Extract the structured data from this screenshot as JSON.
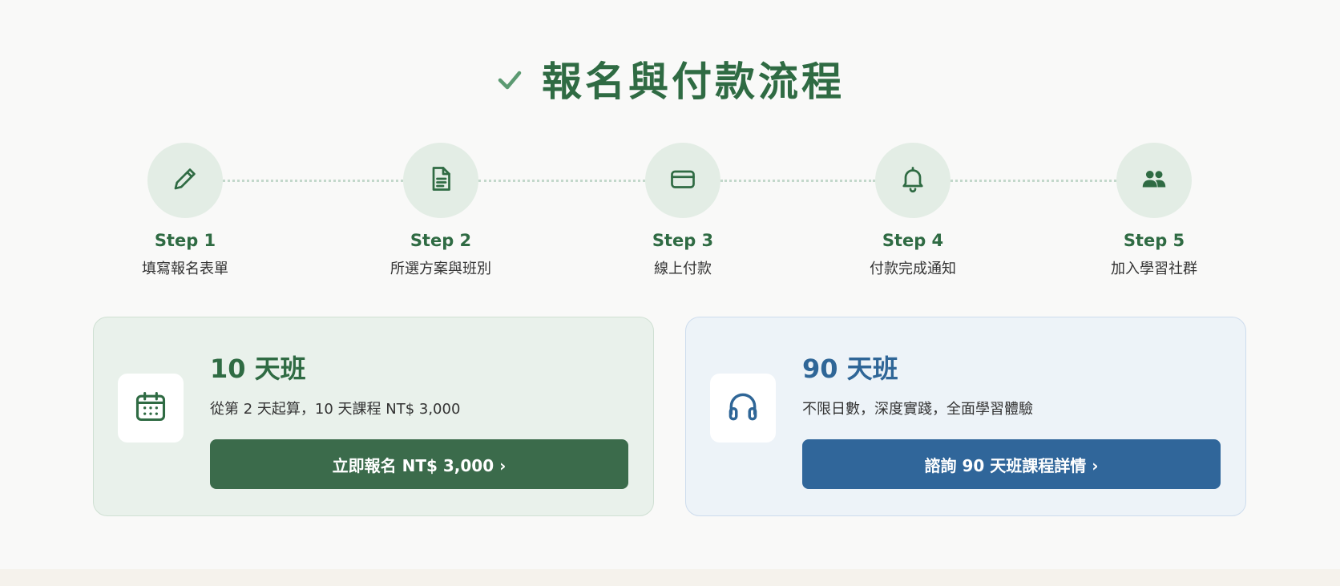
{
  "title": {
    "text": "報名與付款流程",
    "icon": "check-icon"
  },
  "steps": [
    {
      "label": "Step 1",
      "desc": "填寫報名表單",
      "icon": "pencil-icon"
    },
    {
      "label": "Step 2",
      "desc": "所選方案與班別",
      "icon": "document-icon"
    },
    {
      "label": "Step 3",
      "desc": "線上付款",
      "icon": "credit-card-icon"
    },
    {
      "label": "Step 4",
      "desc": "付款完成通知",
      "icon": "bell-icon"
    },
    {
      "label": "Step 5",
      "desc": "加入學習社群",
      "icon": "users-icon"
    }
  ],
  "plans": [
    {
      "title": "10 天班",
      "desc": "從第 2 天起算，10 天課程  NT$ 3,000",
      "button": "立即報名 NT$ 3,000 ›",
      "icon": "calendar-icon",
      "accent": "#3b6b4b"
    },
    {
      "title": "90 天班",
      "desc": "不限日數，深度實踐，全面學習體驗",
      "button": "諮詢 90 天班課程詳情 ›",
      "icon": "headphones-icon",
      "accent": "#30669a"
    }
  ],
  "colors": {
    "brand_green": "#2f6b43",
    "brand_blue": "#2f6697",
    "step_circle": "#e3ede5",
    "background": "#f9f9f8"
  }
}
